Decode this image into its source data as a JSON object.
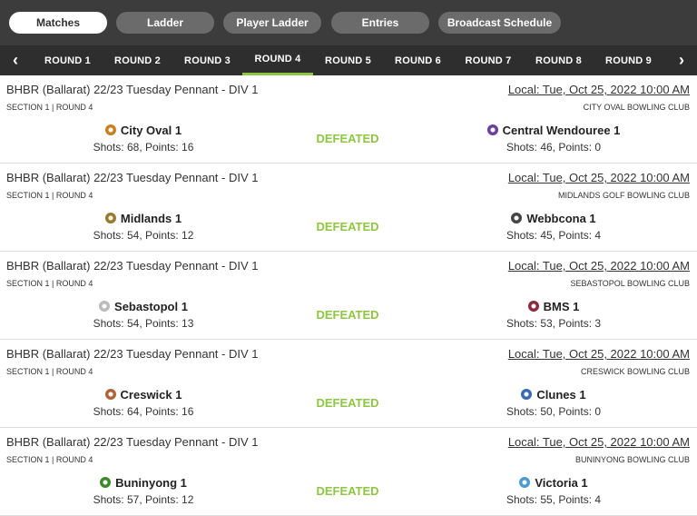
{
  "nav": {
    "tabs": [
      {
        "label": "Matches",
        "active": true
      },
      {
        "label": "Ladder",
        "active": false
      },
      {
        "label": "Player Ladder",
        "active": false
      },
      {
        "label": "Entries",
        "active": false
      },
      {
        "label": "Broadcast Schedule",
        "active": false
      }
    ]
  },
  "rounds": {
    "prev_icon": "‹",
    "next_icon": "›",
    "items": [
      {
        "label": "ROUND 1"
      },
      {
        "label": "ROUND 2"
      },
      {
        "label": "ROUND 3"
      },
      {
        "label": "ROUND 4",
        "active": true
      },
      {
        "label": "ROUND 5"
      },
      {
        "label": "ROUND 6"
      },
      {
        "label": "ROUND 7"
      },
      {
        "label": "ROUND 8"
      },
      {
        "label": "ROUND 9"
      }
    ]
  },
  "colors": {
    "accent": "#8dc63f",
    "topbar": "#3c3c3c",
    "roundbar": "#2e2e2e"
  },
  "matches": [
    {
      "competition": "BHBR (Ballarat) 22/23 Tuesday Pennant - DIV 1",
      "section": "SECTION 1 | ROUND 4",
      "date": "Local: Tue, Oct 25, 2022 10:00 AM",
      "venue": "CITY OVAL BOWLING CLUB",
      "result": "DEFEATED",
      "home": {
        "name": "City Oval 1",
        "score": "Shots: 68, Points: 16",
        "logo_color": "#c8801e",
        "logo_icon": "team-crest-icon"
      },
      "away": {
        "name": "Central Wendouree 1",
        "score": "Shots: 46, Points: 0",
        "logo_color": "#6a3fa0",
        "logo_icon": "team-crest-icon"
      }
    },
    {
      "competition": "BHBR (Ballarat) 22/23 Tuesday Pennant - DIV 1",
      "section": "SECTION 1 | ROUND 4",
      "date": "Local: Tue, Oct 25, 2022 10:00 AM",
      "venue": "MIDLANDS GOLF BOWLING CLUB",
      "result": "DEFEATED",
      "home": {
        "name": "Midlands 1",
        "score": "Shots: 54, Points: 12",
        "logo_color": "#9a7a2a",
        "logo_icon": "team-crest-icon"
      },
      "away": {
        "name": "Webbcona 1",
        "score": "Shots: 45, Points: 4",
        "logo_color": "#444444",
        "logo_icon": "team-crest-icon"
      }
    },
    {
      "competition": "BHBR (Ballarat) 22/23 Tuesday Pennant - DIV 1",
      "section": "SECTION 1 | ROUND 4",
      "date": "Local: Tue, Oct 25, 2022 10:00 AM",
      "venue": "SEBASTOPOL BOWLING CLUB",
      "result": "DEFEATED",
      "home": {
        "name": "Sebastopol 1",
        "score": "Shots: 54, Points: 13",
        "logo_color": "#bbbbbb",
        "logo_icon": "team-crest-icon"
      },
      "away": {
        "name": "BMS 1",
        "score": "Shots: 53, Points: 3",
        "logo_color": "#8a2a3a",
        "logo_icon": "team-crest-icon"
      }
    },
    {
      "competition": "BHBR (Ballarat) 22/23 Tuesday Pennant - DIV 1",
      "section": "SECTION 1 | ROUND 4",
      "date": "Local: Tue, Oct 25, 2022 10:00 AM",
      "venue": "CRESWICK BOWLING CLUB",
      "result": "DEFEATED",
      "home": {
        "name": "Creswick 1",
        "score": "Shots: 64, Points: 16",
        "logo_color": "#b0623a",
        "logo_icon": "team-crest-icon"
      },
      "away": {
        "name": "Clunes 1",
        "score": "Shots: 50, Points: 0",
        "logo_color": "#3a6ab0",
        "logo_icon": "team-crest-icon"
      }
    },
    {
      "competition": "BHBR (Ballarat) 22/23 Tuesday Pennant - DIV 1",
      "section": "SECTION 1 | ROUND 4",
      "date": "Local: Tue, Oct 25, 2022 10:00 AM",
      "venue": "BUNINYONG BOWLING CLUB",
      "result": "DEFEATED",
      "home": {
        "name": "Buninyong 1",
        "score": "Shots: 57, Points: 12",
        "logo_color": "#3a8a2a",
        "logo_icon": "team-crest-icon"
      },
      "away": {
        "name": "Victoria 1",
        "score": "Shots: 55, Points: 4",
        "logo_color": "#4a9ad0",
        "logo_icon": "team-crest-icon"
      }
    }
  ]
}
